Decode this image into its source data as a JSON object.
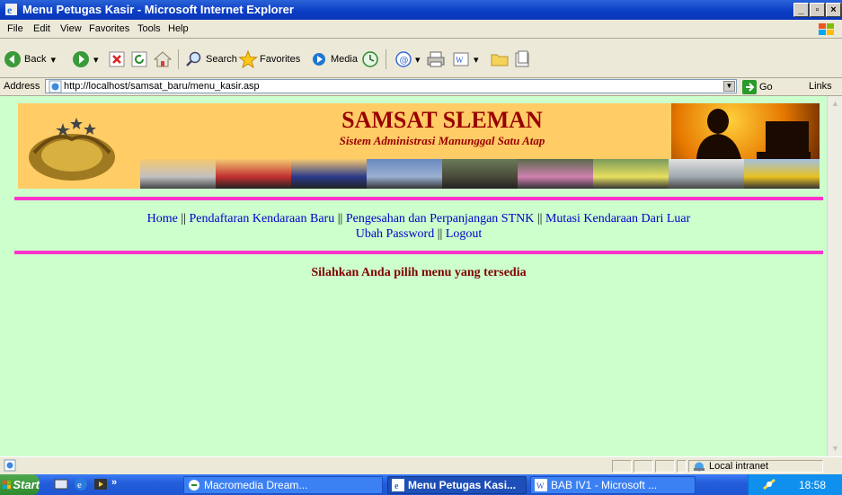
{
  "window": {
    "title": "Menu Petugas Kasir - Microsoft Internet Explorer",
    "minimize": "_",
    "maximize": "▫",
    "close": "×"
  },
  "menu": {
    "items": [
      "File",
      "Edit",
      "View",
      "Favorites",
      "Tools",
      "Help"
    ]
  },
  "toolbar": {
    "back": "Back",
    "search": "Search",
    "favorites": "Favorites",
    "media": "Media"
  },
  "address": {
    "label": "Address",
    "url": "http://localhost/samsat_baru/menu_kasir.asp",
    "go": "Go",
    "links": "Links"
  },
  "banner": {
    "title": "SAMSAT SLEMAN",
    "subtitle": "Sistem Administrasi Manunggal Satu Atap"
  },
  "nav": {
    "home": "Home",
    "pendaftaran": "Pendaftaran Kendaraan Baru",
    "pengesahan": "Pengesahan dan Perpanjangan STNK",
    "mutasi": "Mutasi Kendaraan Dari Luar",
    "ubah_password": "Ubah Password",
    "logout": "Logout",
    "separator": " || "
  },
  "message": "Silahkan Anda pilih menu yang tersedia",
  "status": {
    "zone": "Local intranet"
  },
  "taskbar": {
    "start": "Start",
    "more": "»",
    "tasks": [
      "Macromedia Dream...",
      "Menu Petugas Kasi...",
      "BAB IV1 - Microsoft ..."
    ],
    "clock": "18:58"
  },
  "colors": {
    "page_bg": "#ccffcc",
    "banner_bg": "#ffcc66",
    "rule": "#ff33cc",
    "title": "#990000",
    "link": "#0000cc",
    "message": "#800000"
  }
}
